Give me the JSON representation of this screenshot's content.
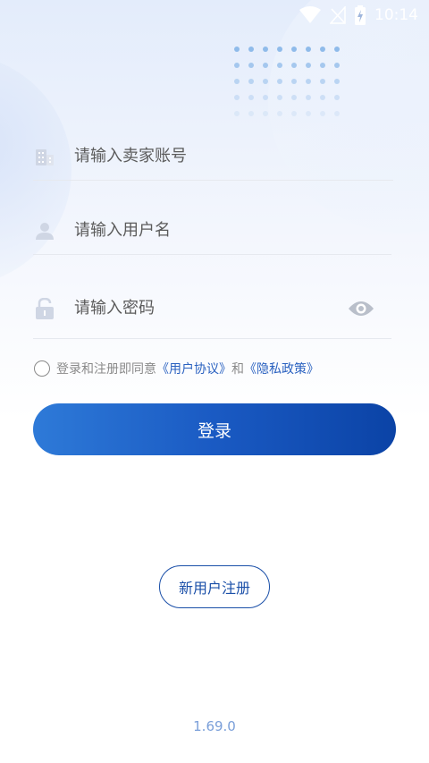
{
  "status_bar": {
    "time": "10:14",
    "icons": [
      "wifi-icon",
      "no-signal-icon",
      "battery-charging-icon"
    ]
  },
  "form": {
    "seller_account": {
      "placeholder": "请输入卖家账号",
      "value": "",
      "icon": "building-icon"
    },
    "username": {
      "placeholder": "请输入用户名",
      "value": "",
      "icon": "user-icon"
    },
    "password": {
      "placeholder": "请输入密码",
      "value": "",
      "icon": "lock-icon",
      "toggle_icon": "eye-icon"
    }
  },
  "agreement": {
    "prefix": "登录和注册即同意",
    "user_agreement": "《用户协议》",
    "conjunction": "和",
    "privacy_policy": "《隐私政策》"
  },
  "buttons": {
    "login": "登录",
    "register": "新用户注册"
  },
  "version": "1.69.0",
  "colors": {
    "primary": "#1a5ac3",
    "link": "#2b62c0",
    "version_text": "#7a9fd9"
  }
}
